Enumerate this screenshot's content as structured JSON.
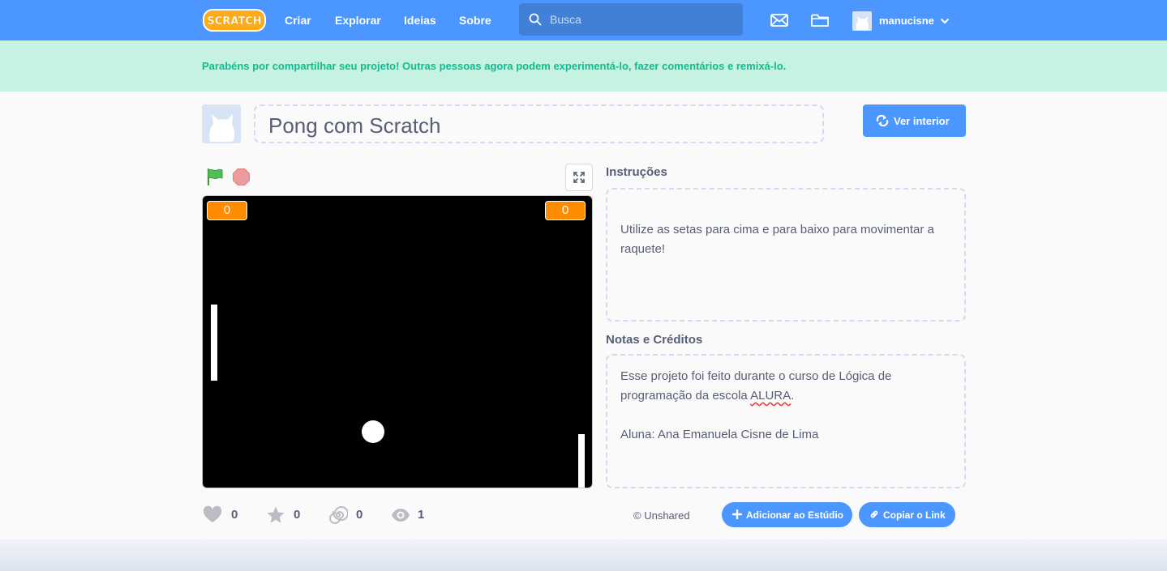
{
  "nav": {
    "logo_text": "SCRATCH",
    "links": [
      "Criar",
      "Explorar",
      "Ideias",
      "Sobre"
    ],
    "search_placeholder": "Busca",
    "username": "manucisne"
  },
  "banner": {
    "message": "Parabéns por compartilhar seu projeto! Outras pessoas agora podem experimentá-lo, fazer comentários e remixá-lo."
  },
  "project": {
    "title": "Pong com Scratch",
    "see_inside_label": "Ver interior"
  },
  "stage": {
    "score_left": "0",
    "score_right": "0"
  },
  "stats": {
    "loves": "0",
    "favorites": "0",
    "remixes": "0",
    "views": "1"
  },
  "instructions": {
    "label": "Instruções",
    "text": "Utilize as setas para cima e para baixo para movimentar a raquete!"
  },
  "notes": {
    "label": "Notas e Créditos",
    "line1": "Esse projeto foi feito durante o curso de Lógica de programação da escola ",
    "line1_spell": "ALURA",
    "line1_end": ".",
    "line2": "Aluna: Ana Emanuela Cisne de Lima"
  },
  "actions": {
    "unshared": "Unshared",
    "add_studio": "Adicionar ao Estúdio",
    "copy_link": "Copiar o Link"
  },
  "colors": {
    "nav_blue": "#4c97ff",
    "banner_green": "#c6f2e3",
    "banner_text": "#0fbd8c",
    "score_orange": "#ff8c00"
  }
}
